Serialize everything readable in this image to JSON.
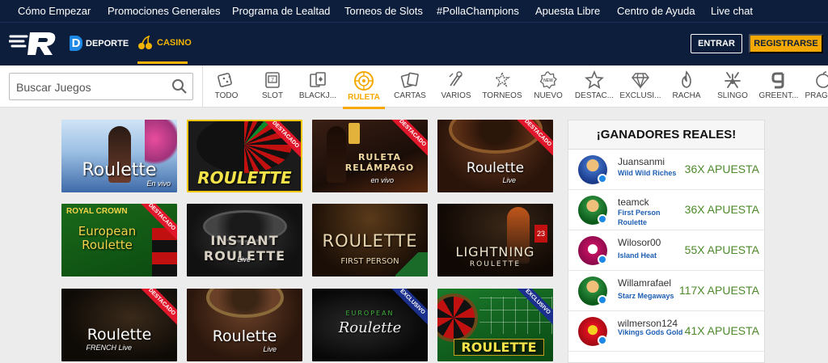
{
  "topnav": [
    "Cómo Empezar",
    "Promociones Generales",
    "Programa de Lealtad",
    "Torneos de Slots",
    "#PollaChampions",
    "Apuesta Libre",
    "Centro de Ayuda",
    "Live chat"
  ],
  "header": {
    "deporte": "DEPORTE",
    "casino": "CASINO",
    "entrar": "ENTRAR",
    "registrarse": "REGISTRARSE"
  },
  "search": {
    "placeholder": "Buscar Juegos"
  },
  "categories": [
    {
      "label": "TODO",
      "icon": "dice-icon"
    },
    {
      "label": "SLOT",
      "icon": "slot-icon"
    },
    {
      "label": "BLACKJ...",
      "icon": "cards-icon"
    },
    {
      "label": "RULETA",
      "icon": "roulette-icon"
    },
    {
      "label": "CARTAS",
      "icon": "playing-cards-icon"
    },
    {
      "label": "VARIOS",
      "icon": "misc-icon"
    },
    {
      "label": "TORNEOS",
      "icon": "tournament-icon"
    },
    {
      "label": "NUEVO",
      "icon": "new-icon"
    },
    {
      "label": "DESTAC...",
      "icon": "star-icon"
    },
    {
      "label": "EXCLUSI...",
      "icon": "diamond-icon"
    },
    {
      "label": "RACHA",
      "icon": "flame-icon"
    },
    {
      "label": "SLINGO",
      "icon": "slingo-icon"
    },
    {
      "label": "GREENT...",
      "icon": "greentube-icon"
    },
    {
      "label": "PRAGM...",
      "icon": "pragmatic-icon"
    }
  ],
  "games": [
    {
      "title": "Roulette",
      "sub": "En vivo",
      "ribbon": ""
    },
    {
      "title": "ROULETTE",
      "sub": "",
      "ribbon": "DESTACADO"
    },
    {
      "title": "RULETA RELÁMPAGO",
      "sub": "en vivo",
      "ribbon": "DESTACADO"
    },
    {
      "title": "Roulette",
      "sub": "Live",
      "ribbon": "DESTACADO"
    },
    {
      "title": "European Roulette",
      "sub": "ROYAL CROWN",
      "ribbon": "DESTACADO"
    },
    {
      "title": "INSTANT ROULETTE",
      "sub": "Live",
      "ribbon": ""
    },
    {
      "title": "ROULETTE",
      "sub": "FIRST PERSON",
      "ribbon": ""
    },
    {
      "title": "LIGHTNING",
      "sub": "ROULETTE",
      "ribbon": ""
    },
    {
      "title": "Roulette",
      "sub": "FRENCH Live",
      "ribbon": "DESTACADO"
    },
    {
      "title": "Roulette",
      "sub": "Live",
      "ribbon": ""
    },
    {
      "title": "Roulette",
      "sub": "EUROPEAN",
      "ribbon": "EXCLUSIVO"
    },
    {
      "title": "ROULETTE",
      "sub": "",
      "ribbon": "EXCLUSIVO"
    }
  ],
  "winners": {
    "title": "¡GANADORES REALES!",
    "rows": [
      {
        "user": "Juansanmi",
        "game": "Wild Wild Riches",
        "mult": "36X APUESTA"
      },
      {
        "user": "teamck",
        "game": "First Person Roulette",
        "mult": "36X APUESTA"
      },
      {
        "user": "Wilosor00",
        "game": "Island Heat",
        "mult": "55X APUESTA"
      },
      {
        "user": "Willamrafael",
        "game": "Starz Megaways",
        "mult": "117X APUESTA"
      },
      {
        "user": "wilmerson124",
        "game": "Vikings Gods Gold",
        "mult": "41X APUESTA"
      }
    ]
  },
  "colors": {
    "navy": "#0c1e3c",
    "accent": "#f5a800",
    "ribbon_red": "#e0162b",
    "ribbon_blue": "#1b2f8c",
    "win_green": "#4d8a2a"
  }
}
